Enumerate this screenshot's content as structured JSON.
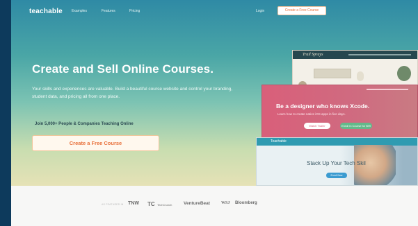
{
  "nav": {
    "logo": "teachable",
    "links": [
      "Examples",
      "Features",
      "Pricing"
    ],
    "login": "Login",
    "cta": "Create a Free Course"
  },
  "hero": {
    "headline": "Create and Sell Online Courses.",
    "subtext": "Your skills and experiences are valuable. Build a beautiful course website and control your branding, student data, and pricing all from one place.",
    "join": "Join 5,000+ People & Companies Teaching Online",
    "cta": "Create a Free Course"
  },
  "previews": {
    "top_brand": "Trail Sprays",
    "mid_title": "Be a designer who knows Xcode.",
    "mid_sub": "Learn how to create native iOS apps in five days.",
    "mid_watch": "Watch Trailer",
    "mid_enroll": "Enroll in Course for $99",
    "bottom_brand": "Teachable",
    "bottom_phrase": "Stack Up Your Tech Skil",
    "bottom_btn": "Enroll Now"
  },
  "press": {
    "label": "AS FEATURED IN",
    "logos": [
      "TNW",
      "TC",
      "TechCrunch",
      "VentureBeat",
      "WSJ",
      "Bloomberg"
    ]
  },
  "colors": {
    "accent": "#e8703a",
    "hero_top": "#2f8aa5",
    "hero_bottom": "#e6e2b6"
  }
}
